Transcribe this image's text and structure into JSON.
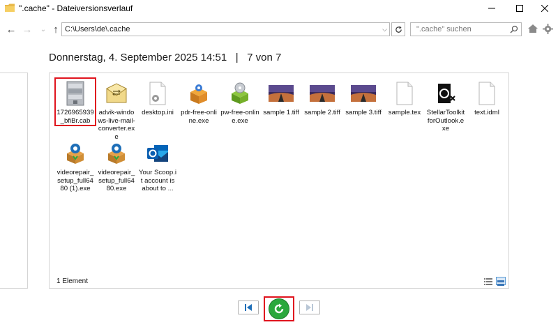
{
  "window": {
    "title": "\".cache\" - Dateiversionsverlauf"
  },
  "nav": {
    "address": "C:\\Users\\de\\.cache",
    "search_placeholder": "\".cache\" suchen"
  },
  "header": {
    "date": "Donnerstag, 4. September 2025 14:51",
    "separator": "|",
    "version": "7 von 7"
  },
  "files": [
    {
      "name": "1726965939_bfiBr.cab",
      "icon": "cab-archive-icon",
      "selected": true
    },
    {
      "name": "advik-windows-live-mail-converter.exe",
      "icon": "envelope-exe-icon"
    },
    {
      "name": "desktop.ini",
      "icon": "ini-settings-file-icon"
    },
    {
      "name": "pdr-free-online.exe",
      "icon": "installer-box-icon"
    },
    {
      "name": "pw-free-online.exe",
      "icon": "installer-cd-icon"
    },
    {
      "name": "sample 1.tiff",
      "icon": "image-thumbnail-icon"
    },
    {
      "name": "sample 2.tiff",
      "icon": "image-thumbnail-icon"
    },
    {
      "name": "sample 3.tiff",
      "icon": "image-thumbnail-icon"
    },
    {
      "name": "sample.tex",
      "icon": "blank-document-icon"
    },
    {
      "name": "StellarToolkitforOutlook.exe",
      "icon": "stellar-outlook-icon"
    },
    {
      "name": "text.idml",
      "icon": "blank-document-icon"
    },
    {
      "name": "videorepair_setup_full6480 (1).exe",
      "icon": "video-repair-installer-icon"
    },
    {
      "name": "videorepair_setup_full6480.exe",
      "icon": "video-repair-installer-icon"
    },
    {
      "name": "Your Scoop.it account is about to ...",
      "icon": "outlook-message-icon"
    }
  ],
  "status": {
    "count": "1 Element"
  },
  "colors": {
    "highlight": "#e0141e",
    "restore_green": "#2aa83d",
    "border": "#d4d4d4"
  }
}
